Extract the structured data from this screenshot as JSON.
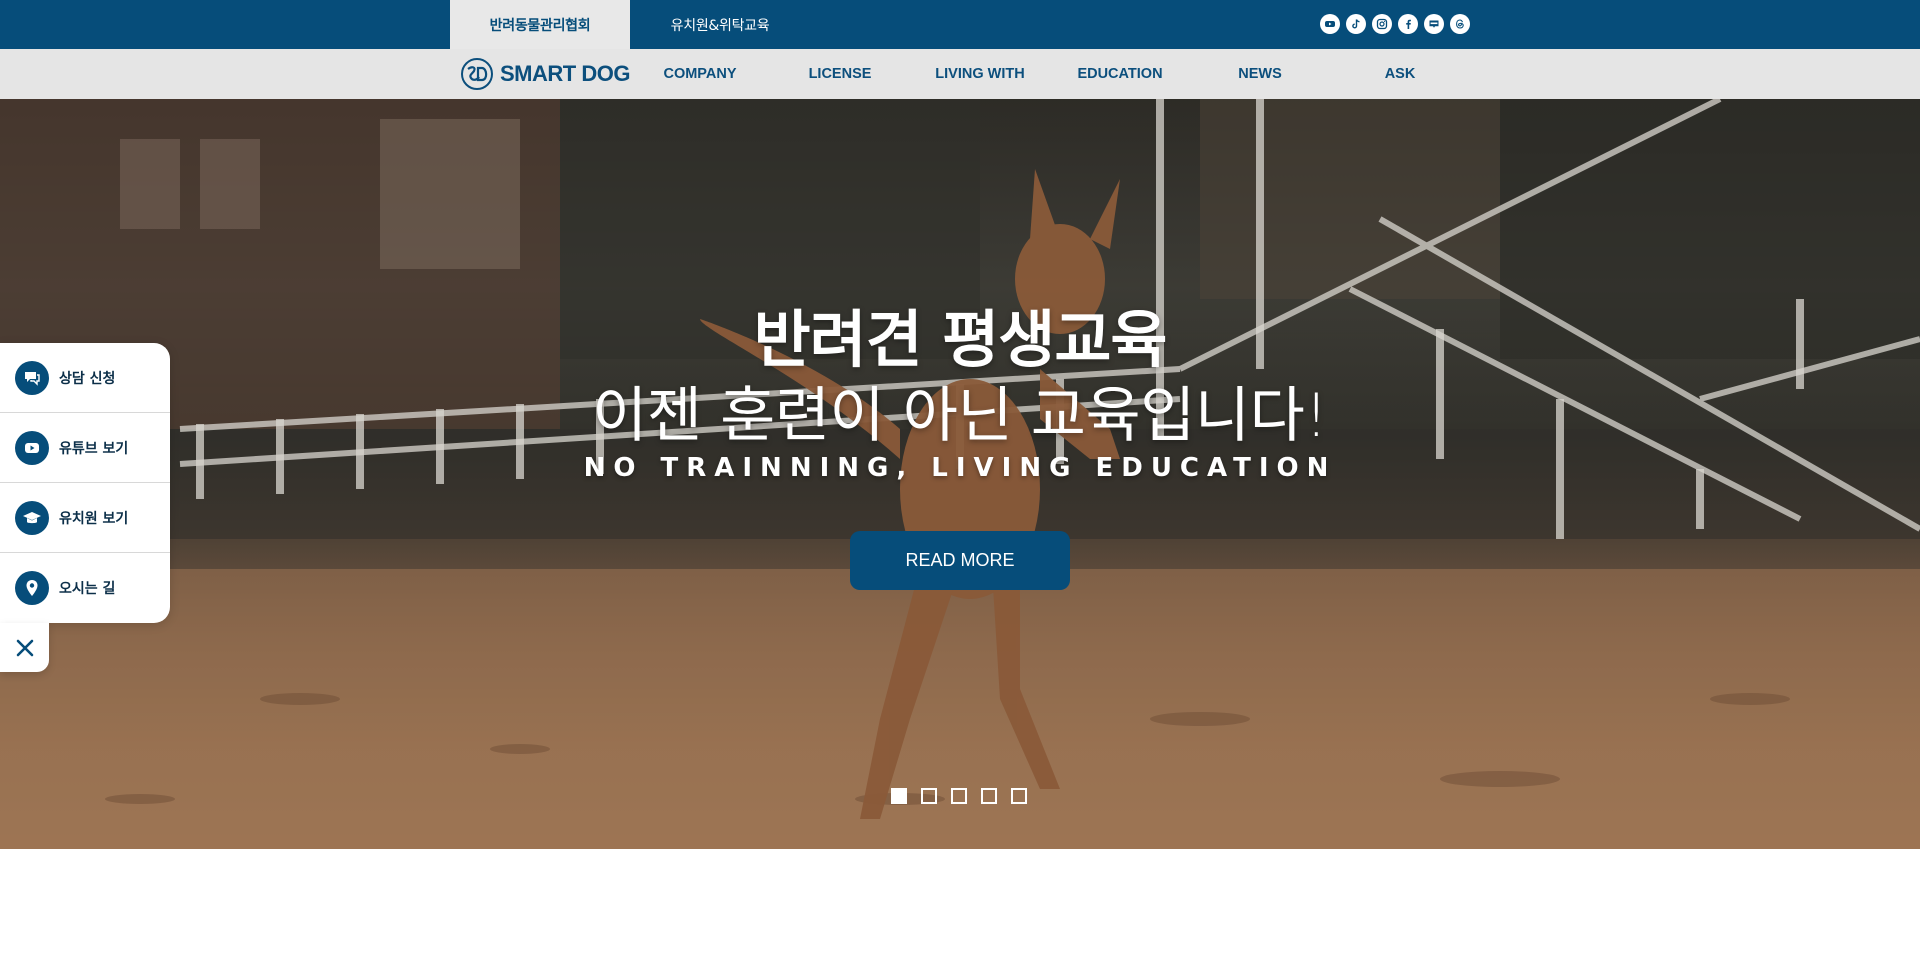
{
  "topbar": {
    "tabs": [
      "반려동물관리협회",
      "유치원&위탁교육"
    ],
    "social_icons": [
      "youtube-icon",
      "tiktok-icon",
      "instagram-icon",
      "facebook-icon",
      "blog-icon",
      "threads-icon"
    ]
  },
  "nav": {
    "logo_text": "SMART DOG",
    "items": [
      "COMPANY",
      "LICENSE",
      "LIVING WITH",
      "EDUCATION",
      "NEWS",
      "ASK"
    ]
  },
  "hero": {
    "title": "반려견 평생교육",
    "subtitle": "이젠 훈련이 아닌 교육입니다!",
    "tagline": "NO TRAINNING, LIVING EDUCATION",
    "button_label": "READ MORE",
    "slide_count": 5,
    "active_slide": 1
  },
  "quick_menu": {
    "items": [
      {
        "label": "상담 신청",
        "icon": "chat-icon"
      },
      {
        "label": "유튜브 보기",
        "icon": "play-icon"
      },
      {
        "label": "유치원 보기",
        "icon": "graduation-cap-icon"
      },
      {
        "label": "오시는 길",
        "icon": "map-pin-icon"
      }
    ],
    "close_icon": "close-icon"
  },
  "colors": {
    "brand": "#064d7a",
    "nav_bg": "#e5e5e5"
  }
}
